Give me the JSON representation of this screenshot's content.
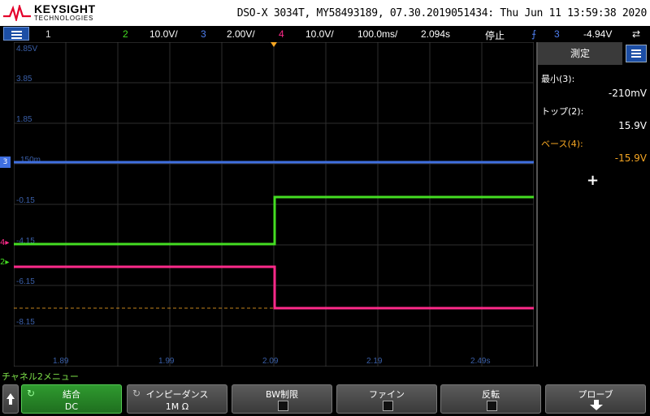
{
  "header": {
    "brand": "KEYSIGHT",
    "brand_sub": "TECHNOLOGIES",
    "title": "DSO-X 3034T, MY58493189, 07.30.2019051434: Thu Jun 11 13:59:38 2020"
  },
  "status_bar": {
    "ch1_num": "1",
    "ch2_num": "2",
    "ch2_scale": "10.0V/",
    "ch3_num": "3",
    "ch3_scale": "2.00V/",
    "ch4_num": "4",
    "ch4_scale": "10.0V/",
    "timebase": "100.0ms/",
    "delay": "2.094s",
    "run_state": "停止",
    "trigger_channel": "3",
    "trigger_level": "-4.94V"
  },
  "graticule": {
    "y_labels": [
      "4.85V",
      "3.85",
      "1.85",
      "150m",
      "-0.15",
      "-4.15",
      "-6.15",
      "-8.15"
    ],
    "x_labels": [
      "1.89",
      "1.99",
      "2.09",
      "2.19",
      "2.49s"
    ],
    "ref_markers": [
      "3",
      "4",
      "2"
    ]
  },
  "measure_panel": {
    "title": "測定",
    "items": [
      {
        "label": "最小(3):",
        "value": "-210mV",
        "color": "#ffffff"
      },
      {
        "label": "トップ(2):",
        "value": "15.9V",
        "color": "#ffffff"
      },
      {
        "label": "ベース(4):",
        "value": "-15.9V",
        "color": "#f5a623"
      }
    ],
    "add_symbol": "+"
  },
  "softkey_menu": {
    "title": "チャネル2メニュー",
    "keys": [
      {
        "label": "結合",
        "value": "DC"
      },
      {
        "label": "インピーダンス",
        "value": "1M Ω"
      },
      {
        "label": "BW制限",
        "value": ""
      },
      {
        "label": "ファイン",
        "value": ""
      },
      {
        "label": "反転",
        "value": ""
      },
      {
        "label": "プローブ",
        "value": ""
      }
    ]
  },
  "colors": {
    "ch1": "#e6e600",
    "ch2": "#44dd22",
    "ch3": "#3f6fe0",
    "ch4": "#ff2a8a",
    "accent": "#1c4ea5"
  }
}
